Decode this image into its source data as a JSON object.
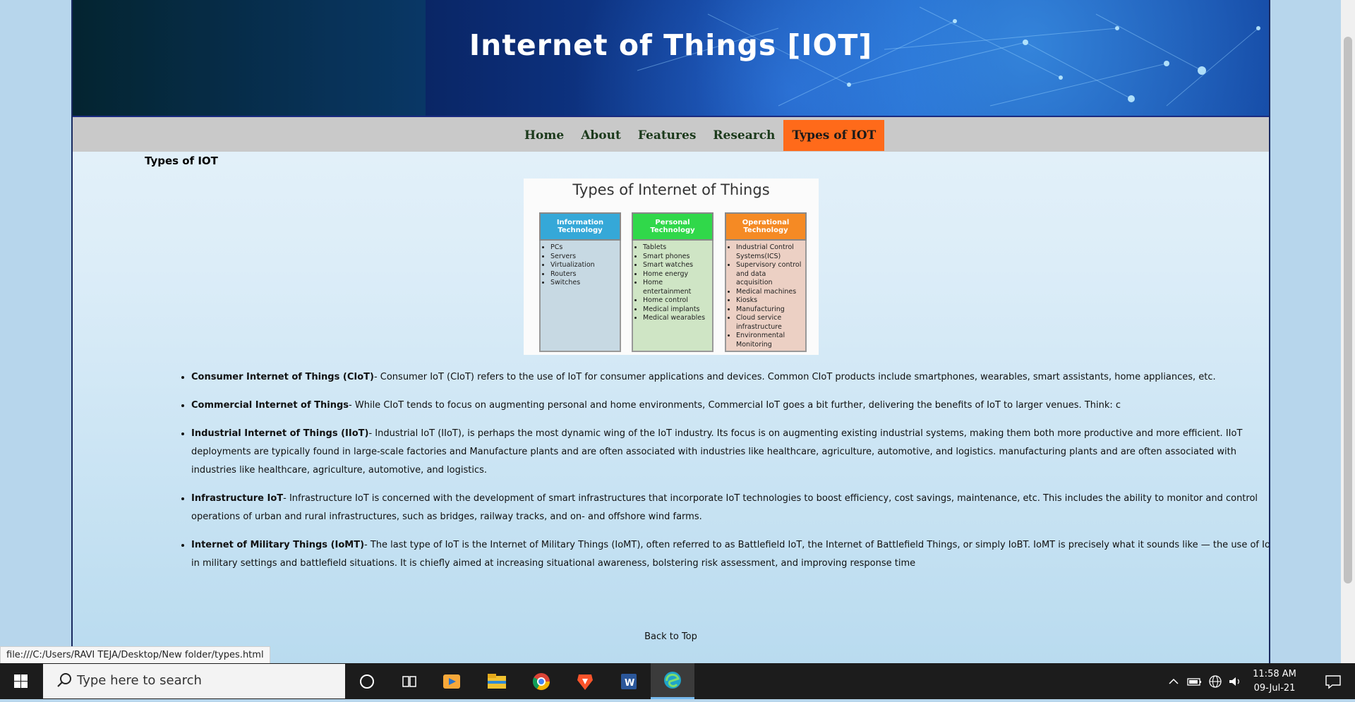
{
  "banner": {
    "title": "Internet of Things [IOT]"
  },
  "nav": {
    "items": [
      {
        "label": "Home"
      },
      {
        "label": "About"
      },
      {
        "label": "Features"
      },
      {
        "label": "Research"
      },
      {
        "label": "Types of IOT",
        "active": true
      }
    ]
  },
  "section_title": "Types of IOT",
  "figure": {
    "title": "Types of Internet of Things",
    "columns": [
      {
        "header": "Information Technology",
        "items": [
          "PCs",
          "Servers",
          "Virtualization",
          "Routers",
          "Switches"
        ]
      },
      {
        "header": "Personal Technology",
        "items": [
          "Tablets",
          "Smart phones",
          "Smart watches",
          "Home energy",
          "Home entertainment",
          "Home control",
          "Medical implants",
          "Medical wearables"
        ]
      },
      {
        "header": "Operational Technology",
        "items": [
          "Industrial Control Systems(ICS)",
          "Supervisory control and data acquisition",
          "Medical machines",
          "Kiosks",
          "Manufacturing",
          "Cloud service infrastructure",
          "Environmental Monitoring"
        ]
      }
    ]
  },
  "bullets": [
    {
      "term": "Consumer Internet of Things (CIoT)",
      "text": "- Consumer IoT (CIoT) refers to the use of IoT for consumer applications and devices. Common CIoT products include smartphones, wearables, smart assistants, home appliances, etc."
    },
    {
      "term": "Commercial Internet of Things",
      "text": "- While CIoT tends to focus on augmenting personal and home environments, Commercial IoT goes a bit further, delivering the benefits of IoT to larger venues. Think: c"
    },
    {
      "term": "Industrial Internet of Things (IIoT)",
      "text": "- Industrial IoT (IIoT), is perhaps the most dynamic wing of the IoT industry. Its focus is on augmenting existing industrial systems, making them both more productive and more efficient. IIoT deployments are typically found in large-scale factories and Manufacture plants and are often associated with industries like healthcare, agriculture, automotive, and logistics. manufacturing plants and are often associated with industries like healthcare, agriculture, automotive, and logistics."
    },
    {
      "term": "Infrastructure IoT",
      "text": "- Infrastructure IoT is concerned with the development of smart infrastructures that incorporate IoT technologies to boost efficiency, cost savings, maintenance, etc. This includes the ability to monitor and control operations of urban and rural infrastructures, such as bridges, railway tracks, and on- and offshore wind farms."
    },
    {
      "term": "Internet of Military Things (IoMT)",
      "text": "- The last type of IoT is the Internet of Military Things (IoMT), often referred to as Battlefield IoT, the Internet of Battlefield Things, or simply IoBT. IoMT is precisely what it sounds like — the use of IoT in military settings and battlefield situations. It is chiefly aimed at increasing situational awareness, bolstering risk assessment, and improving response time"
    }
  ],
  "back_to_top": "Back to Top",
  "status_url": "file:///C:/Users/RAVI TEJA/Desktop/New folder/types.html",
  "taskbar": {
    "search_placeholder": "Type here to search",
    "time": "11:58 AM",
    "date": "09-Jul-21",
    "icons": [
      "windows-start-icon",
      "cortana-icon",
      "task-view-icon",
      "media-player-icon",
      "file-explorer-icon",
      "chrome-icon",
      "brave-icon",
      "word-icon",
      "edge-icon"
    ]
  },
  "colors": {
    "nav_active": "#ff6a1a",
    "nav_bg": "#c9c9c9",
    "banner": "#0b2a70"
  }
}
